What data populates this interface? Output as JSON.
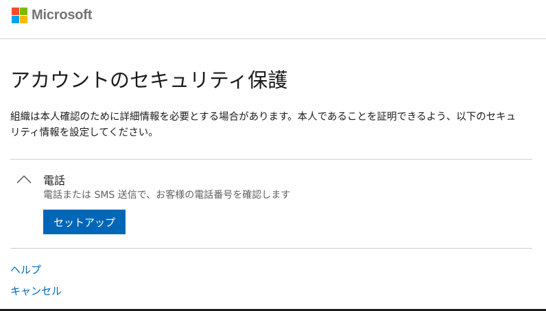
{
  "header": {
    "brand_name": "Microsoft",
    "logo_colors": [
      "#f25022",
      "#7fba00",
      "#00a4ef",
      "#ffb900"
    ]
  },
  "main": {
    "title": "アカウントのセキュリティ保護",
    "description": "組織は本人確認のために詳細情報を必要とする場合があります。本人であることを証明できるよう、以下のセキュリティ情報を設定してください。"
  },
  "method": {
    "title": "電話",
    "description": "電話または SMS 送信で、お客様の電話番号を確認します",
    "setup_label": "セットアップ",
    "expanded_icon": "chevron-up-icon"
  },
  "links": {
    "help": "ヘルプ",
    "cancel": "キャンセル"
  },
  "colors": {
    "accent": "#0067b8",
    "text": "#1b1b1b",
    "muted": "#616161"
  }
}
